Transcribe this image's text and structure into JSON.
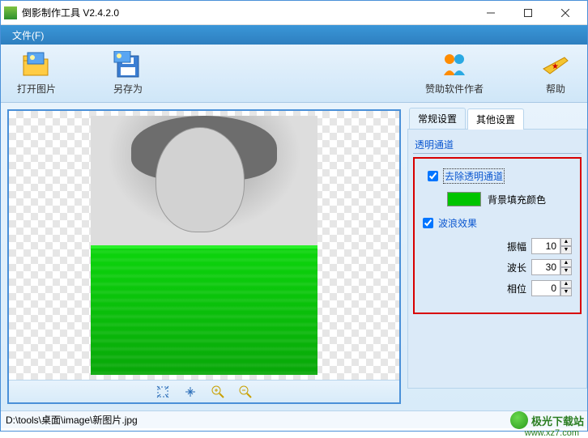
{
  "titlebar": {
    "title": "倒影制作工具 V2.4.2.0"
  },
  "menu": {
    "file": "文件(F)"
  },
  "toolbar": {
    "open": "打开图片",
    "saveas": "另存为",
    "sponsor": "赞助软件作者",
    "help": "帮助"
  },
  "tabs": {
    "general": "常规设置",
    "other": "其他设置"
  },
  "panel": {
    "alpha_group": "透明通道",
    "remove_alpha": "去除透明通道",
    "fill_color_label": "背景填充颜色",
    "fill_color": "#00c400",
    "wave_group": "波浪效果",
    "amplitude_label": "振幅",
    "amplitude": "10",
    "wavelength_label": "波长",
    "wavelength": "30",
    "phase_label": "相位",
    "phase": "0"
  },
  "status": {
    "path": "D:\\tools\\桌面\\image\\新图片.jpg"
  },
  "watermark": {
    "text": "极光下载站",
    "url": "www.xz7.com"
  }
}
